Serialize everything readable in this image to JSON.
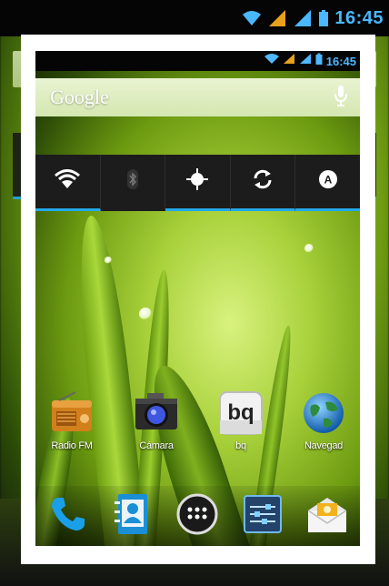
{
  "status_bar": {
    "time": "16:45"
  },
  "search_bar": {
    "label": "Google"
  },
  "quick_toggles": [
    {
      "name": "wifi",
      "active": true
    },
    {
      "name": "bluetooth",
      "active": false
    },
    {
      "name": "gps",
      "active": true
    },
    {
      "name": "sync",
      "active": true
    },
    {
      "name": "auto-brightness",
      "active": true
    }
  ],
  "home_apps": [
    {
      "label": "Radio FM",
      "icon": "radio-icon"
    },
    {
      "label": "Cámara",
      "icon": "camera-icon"
    },
    {
      "label": "bq",
      "icon": "bq-icon",
      "icon_text": "bq"
    },
    {
      "label": "Navegad",
      "icon": "globe-icon"
    }
  ],
  "dock": [
    {
      "name": "phone",
      "icon": "phone-icon"
    },
    {
      "name": "contacts",
      "icon": "contacts-icon"
    },
    {
      "name": "app-drawer",
      "icon": "app-drawer-icon"
    },
    {
      "name": "settings",
      "icon": "settings-sliders-icon"
    },
    {
      "name": "messaging",
      "icon": "email-icon"
    }
  ],
  "colors": {
    "accent": "#23a8ea",
    "clock": "#4fb7ff"
  }
}
